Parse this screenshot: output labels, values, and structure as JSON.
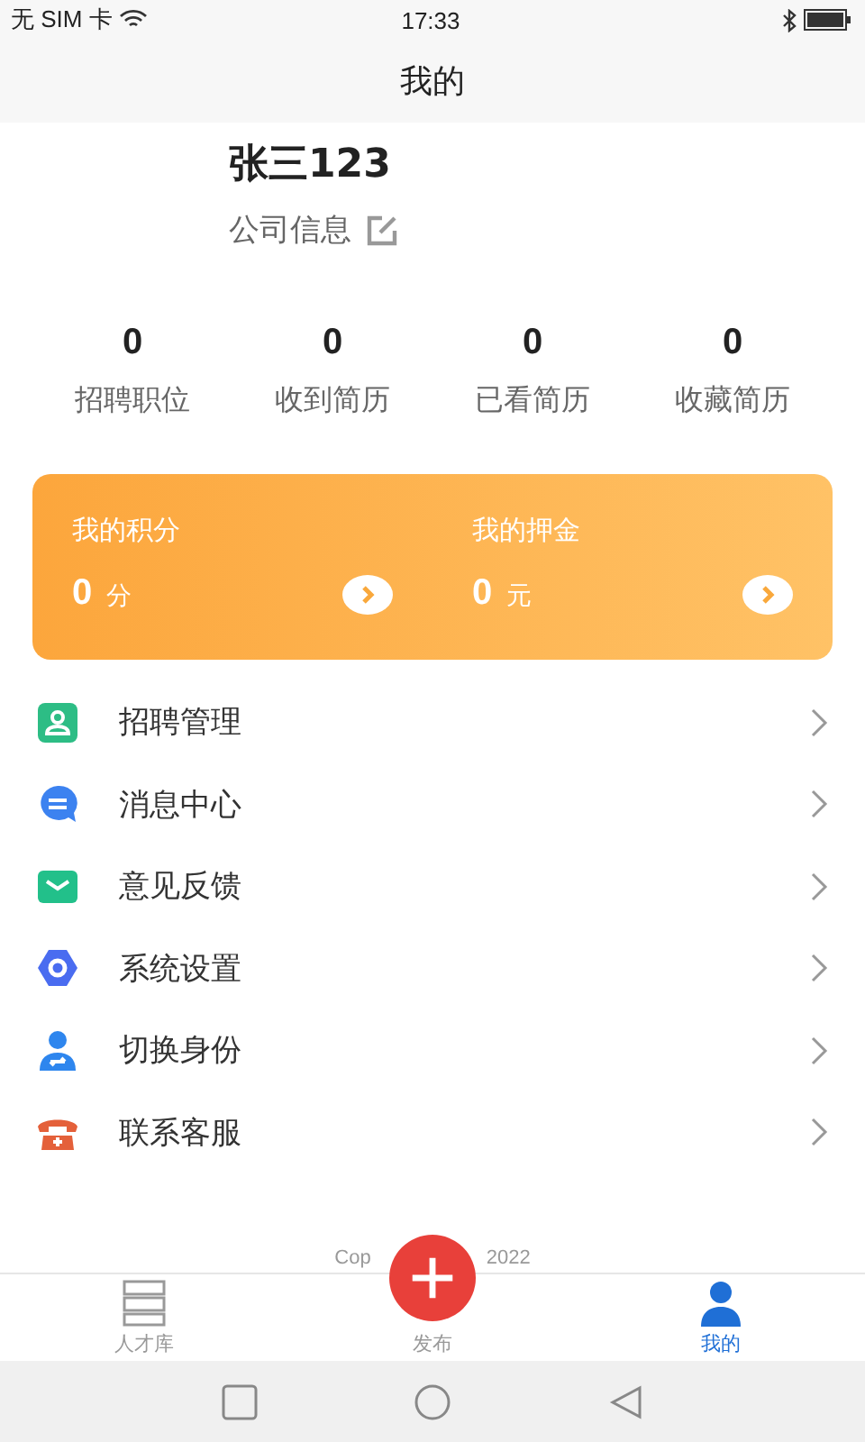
{
  "status_bar": {
    "carrier": "无 SIM 卡",
    "time": "17:33"
  },
  "header": {
    "title": "我的"
  },
  "profile": {
    "name": "张三123",
    "company_link": "公司信息"
  },
  "stats": [
    {
      "value": "0",
      "label": "招聘职位"
    },
    {
      "value": "0",
      "label": "收到简历"
    },
    {
      "value": "0",
      "label": "已看简历"
    },
    {
      "value": "0",
      "label": "收藏简历"
    }
  ],
  "wallet": [
    {
      "title": "我的积分",
      "value": "0",
      "unit": "分"
    },
    {
      "title": "我的押金",
      "value": "0",
      "unit": "元"
    }
  ],
  "menu": [
    {
      "kind": "recruit",
      "label": "招聘管理"
    },
    {
      "kind": "message",
      "label": "消息中心"
    },
    {
      "kind": "feedback",
      "label": "意见反馈"
    },
    {
      "kind": "settings",
      "label": "系统设置"
    },
    {
      "kind": "switch",
      "label": "切换身份"
    },
    {
      "kind": "service",
      "label": "联系客服"
    }
  ],
  "copyright": [
    "Cop",
    "2022"
  ],
  "tab_bar": [
    {
      "kind": "talent",
      "label": "人才库",
      "selected": false
    },
    {
      "kind": "post",
      "label": "发布",
      "selected": false
    },
    {
      "kind": "me",
      "label": "我的",
      "selected": true
    }
  ]
}
